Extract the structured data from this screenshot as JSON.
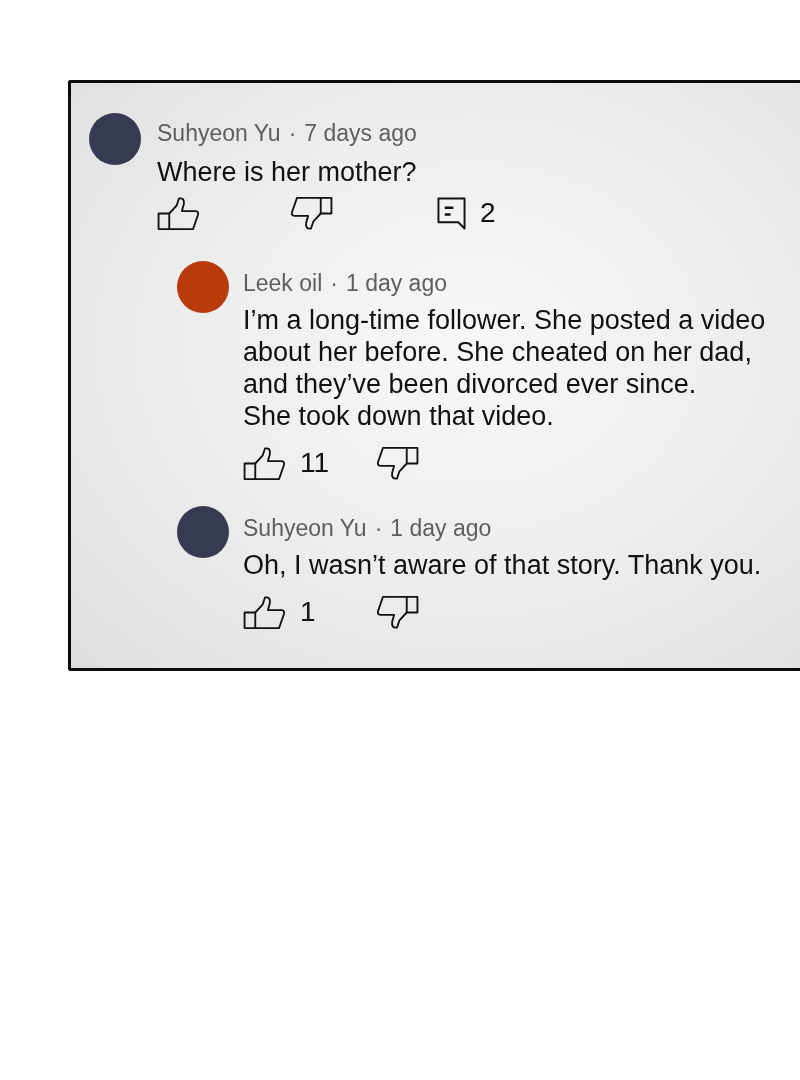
{
  "comments": [
    {
      "author": "Suhyeon Yu",
      "separator": "·",
      "time": "7 days ago",
      "color": "#363a52",
      "text": "Where is her mother?",
      "actions": [
        {
          "kind": "like"
        },
        {
          "kind": "dislike"
        },
        {
          "kind": "reply",
          "count": "2"
        }
      ],
      "replies": [
        {
          "author": "Leek oil",
          "separator": "·",
          "time": "1 day ago",
          "color": "#b93b0b",
          "text": "I’m a long-time follower. She posted a video about her before. She cheated on her dad, and they’ve been divorced ever since.\nShe took down that video.",
          "actions": [
            {
              "kind": "like",
              "count": "11"
            },
            {
              "kind": "dislike"
            }
          ]
        },
        {
          "author": "Suhyeon Yu",
          "separator": "·",
          "time": "1 day ago",
          "color": "#363a52",
          "text": "Oh, I wasn’t aware of that story. Thank you.",
          "actions": [
            {
              "kind": "like",
              "count": "1"
            },
            {
              "kind": "dislike"
            }
          ]
        }
      ]
    }
  ]
}
